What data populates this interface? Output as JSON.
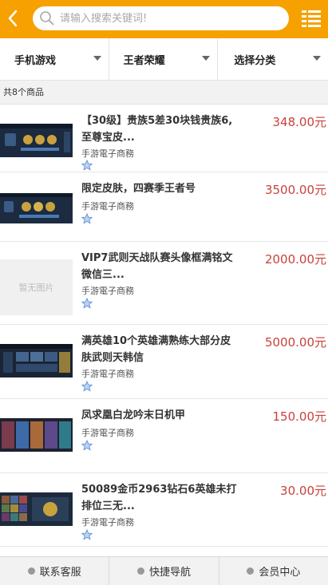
{
  "search": {
    "placeholder": "请输入搜索关键词!"
  },
  "filters": [
    {
      "label": "手机游戏"
    },
    {
      "label": "王者荣耀"
    },
    {
      "label": "选择分类"
    }
  ],
  "count_text": "共8个商品",
  "items": [
    {
      "title_line1": "【30级】贵族5差30块钱贵族6,",
      "title_line2": "至尊宝皮...",
      "seller": "手游電子商務",
      "price": "348.00元",
      "has_image": true
    },
    {
      "title_line1": "限定皮肤，四赛季王者号",
      "title_line2": "",
      "seller": "手游電子商務",
      "price": "3500.00元",
      "has_image": true
    },
    {
      "title_line1": "VIP7武则天战队赛头像框满铭文",
      "title_line2": "微信三...",
      "seller": "手游電子商務",
      "price": "2000.00元",
      "has_image": false,
      "placeholder_text": "暂无图片"
    },
    {
      "title_line1": "满英雄10个英雄满熟练大部分皮",
      "title_line2": "肤武则天韩信",
      "seller": "手游電子商務",
      "price": "5000.00元",
      "has_image": true
    },
    {
      "title_line1": "凤求凰白龙吟末日机甲",
      "title_line2": "",
      "seller": "手游電子商務",
      "price": "150.00元",
      "has_image": true
    },
    {
      "title_line1": "50089金币2963钻石6英雄未打",
      "title_line2": "排位三无...",
      "seller": "手游電子商務",
      "price": "30.00元",
      "has_image": true
    }
  ],
  "footer": [
    {
      "label": "联系客服"
    },
    {
      "label": "快捷导航"
    },
    {
      "label": "会员中心"
    }
  ],
  "colors": {
    "header": "#f6a100",
    "price": "#c8413a",
    "star": "#5b8fd6"
  }
}
